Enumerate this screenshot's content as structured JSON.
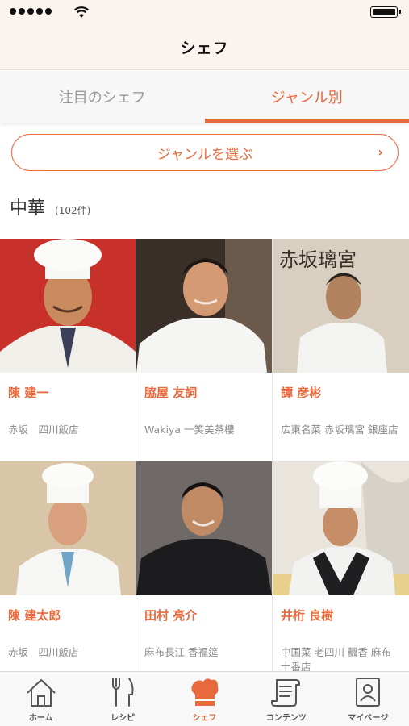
{
  "screen": {
    "title": "シェフ"
  },
  "tabs": [
    {
      "label": "注目のシェフ",
      "active": false
    },
    {
      "label": "ジャンル別",
      "active": true
    }
  ],
  "genre_button": {
    "label": "ジャンルを選ぶ",
    "chevron": "›"
  },
  "section": {
    "title": "中華",
    "count": "(102件)"
  },
  "chefs": [
    {
      "name": "陳 建一",
      "restaurant": "赤坂　四川飯店",
      "photo_bg": "#c8302a"
    },
    {
      "name": "脇屋 友詞",
      "restaurant": "Wakiya 一笑美茶樓",
      "photo_bg": "#3a2e28"
    },
    {
      "name": "譚 彦彬",
      "restaurant": "広東名菜 赤坂璃宮 銀座店",
      "photo_bg": "#d8cfc0",
      "sign_text": "赤坂璃宮"
    },
    {
      "name": "陳 建太郎",
      "restaurant": "赤坂　四川飯店",
      "photo_bg": "#d9c6a8"
    },
    {
      "name": "田村 亮介",
      "restaurant": "麻布長江 香福筵",
      "photo_bg": "#6f6a68"
    },
    {
      "name": "井桁 良樹",
      "restaurant": "中国菜 老四川 飄香 麻布十番店",
      "photo_bg": "#e9e4dc"
    }
  ],
  "bottom_nav": [
    {
      "label": "ホーム",
      "icon": "home-icon",
      "active": false
    },
    {
      "label": "レシピ",
      "icon": "fork-knife-icon",
      "active": false
    },
    {
      "label": "シェフ",
      "icon": "chef-hat-icon",
      "active": true
    },
    {
      "label": "コンテンツ",
      "icon": "scroll-icon",
      "active": false
    },
    {
      "label": "マイページ",
      "icon": "profile-card-icon",
      "active": false
    }
  ],
  "colors": {
    "accent": "#e8693c",
    "header_bg": "#fbf3ee"
  }
}
